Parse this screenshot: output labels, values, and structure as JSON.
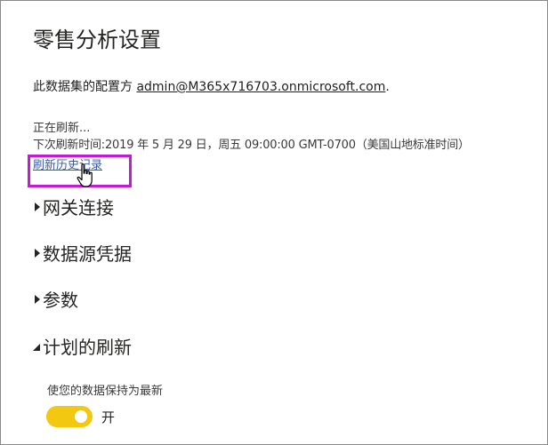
{
  "page": {
    "title": "零售分析设置"
  },
  "owner": {
    "prefix": "此数据集的配置方 ",
    "email": "admin@M365x716703.onmicrosoft.com",
    "suffix": "."
  },
  "refresh": {
    "status": "正在刷新...",
    "next_refresh": "下次刷新时间:2019 年 5 月 29 日，周五 09:00:00 GMT-0700（美国山地标准时间）",
    "history_link": "刷新历史记录"
  },
  "sections": {
    "gateway": "网关连接",
    "credentials": "数据源凭据",
    "parameters": "参数",
    "scheduled": "计划的刷新"
  },
  "scheduled_refresh": {
    "keep_updated_label": "使您的数据保持为最新",
    "toggle_state": "开",
    "toggle_on": true
  },
  "colors": {
    "toggle_on": "#f2c811",
    "link": "#3a5ca8",
    "highlight": "#c21bd6"
  },
  "icons": {
    "collapsed": "caret-right-icon",
    "expanded": "caret-down-icon",
    "cursor": "hand-pointer-icon"
  }
}
